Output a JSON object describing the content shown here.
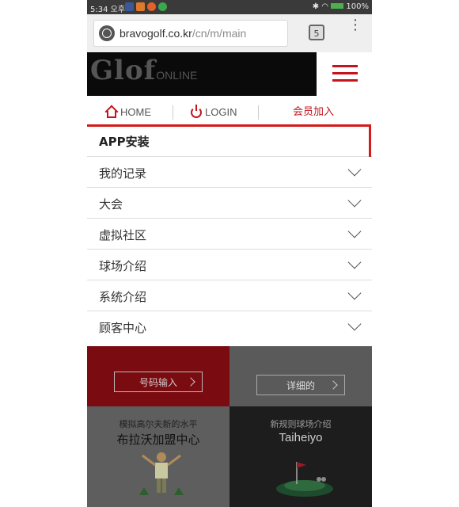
{
  "status_bar": {
    "time": "5:34 오후",
    "battery": "100%"
  },
  "browser": {
    "url_domain": "bravogolf.co.kr",
    "url_path": "/cn/m/main",
    "tab_count": "5"
  },
  "site": {
    "logo_main": "Glof",
    "logo_sub": "ONLINE",
    "accent_color": "#c4141c"
  },
  "nav": {
    "home": "HOME",
    "login": "LOGIN",
    "join": "会员加入"
  },
  "menu": {
    "items": [
      {
        "label": "APP安装"
      },
      {
        "label": "我的记录"
      },
      {
        "label": "大会"
      },
      {
        "label": "虚拟社区"
      },
      {
        "label": "球场介绍"
      },
      {
        "label": "系统介绍"
      },
      {
        "label": "顾客中心"
      }
    ]
  },
  "background": {
    "number_input_button": "号码输入",
    "detail_button": "详细的",
    "tile_left_sub": "模拟高尔夫新的水平",
    "tile_left_title": "布拉沃加盟中心",
    "tile_right_sub": "新规则球场介绍",
    "tile_right_title": "Taiheiyo"
  }
}
